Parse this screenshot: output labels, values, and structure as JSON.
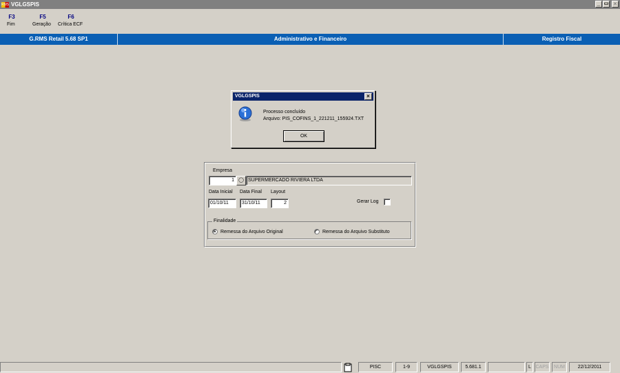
{
  "window": {
    "title": "VGLGSPIS",
    "logo_text": "RMS",
    "minimize": "_",
    "maximize": "\u0006",
    "close": "×"
  },
  "toolbar": {
    "keys": [
      {
        "key": "F3",
        "label": "Fim"
      },
      {
        "key": "F5",
        "label": "Geração"
      },
      {
        "key": "F6",
        "label": "Crítica ECF"
      }
    ]
  },
  "module_bar": {
    "product": "G.RMS Retail 5.68 SP1",
    "area": "Administrativo e Financeiro",
    "module": "Registro Fiscal",
    "color": "#0a5fb4"
  },
  "dialog": {
    "title": "VGLGSPIS",
    "close": "×",
    "icon": "info-icon",
    "message_line1": "Processo concluído",
    "message_line2": "Arquivo: PIS_COFINS_1_221211_155924.TXT",
    "ok_label": "OK"
  },
  "form": {
    "empresa_label": "Empresa",
    "empresa_code": "1",
    "empresa_lookup_icon": "binoculars-icon",
    "empresa_name": "SUPERMERCADO RIVIERA LTDA",
    "data_inicial_label": "Data Inicial",
    "data_inicial": "01/10/11",
    "data_final_label": "Data Final",
    "data_final": "31/10/11",
    "layout_label": "Layout",
    "layout": "2",
    "gerar_log_label": "Gerar Log",
    "gerar_log_checked": false,
    "finalidade_label": "Finalidade",
    "finalidade_options": [
      {
        "label": "Remessa do Arquivo Original",
        "selected": true
      },
      {
        "label": "Remessa do Arquivo Substituto",
        "selected": false
      }
    ]
  },
  "status_bar": {
    "clipboard_icon": "clipboard-icon",
    "program": "PISC",
    "range": "1-9",
    "form_name": "VGLGSPIS",
    "version": "5.681.1",
    "mode": "L",
    "caps": "CAPS",
    "num": "NUM",
    "date": "22/12/2011"
  }
}
